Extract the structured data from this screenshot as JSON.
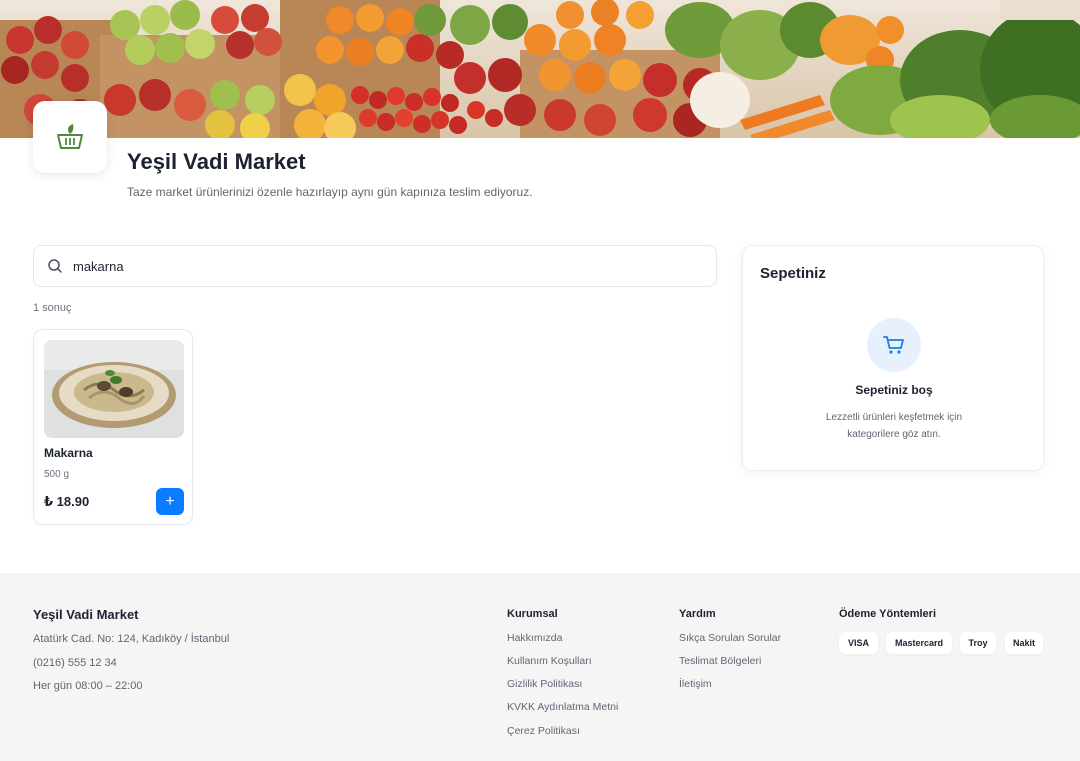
{
  "store": {
    "name": "Yeşil Vadi Market",
    "description": "Taze market ürünlerinizi özenle hazırlayıp aynı gün kapınıza teslim ediyoruz.",
    "logo_icon": "basket-leaf-icon"
  },
  "search": {
    "value": "makarna",
    "icon": "search-icon"
  },
  "results": {
    "count_label": "1 sonuç",
    "products": [
      {
        "name": "Makarna",
        "weight": "500 g",
        "price": "₺ 18.90",
        "add_label": "+"
      }
    ]
  },
  "cart": {
    "title": "Sepetiniz",
    "empty_title": "Sepetiniz boş",
    "empty_desc": "Lezzetli ürünleri keşfetmek için kategorilere göz atın.",
    "icon": "cart-icon"
  },
  "footer": {
    "brand": "Yeşil Vadi Market",
    "address": "Atatürk Cad. No: 124, Kadıköy / İstanbul",
    "phone": "(0216) 555 12 34",
    "hours": "Her gün 08:00 – 22:00",
    "corporate": {
      "title": "Kurumsal",
      "links": [
        "Hakkımızda",
        "Kullanım Koşulları",
        "Gizlilik Politikası",
        "KVKK Aydınlatma Metni",
        "Çerez Politikası"
      ]
    },
    "help": {
      "title": "Yardım",
      "links": [
        "Sıkça Sorulan Sorular",
        "Teslimat Bölgeleri",
        "İletişim"
      ]
    },
    "payment": {
      "title": "Ödeme Yöntemleri",
      "methods": [
        "VISA",
        "Mastercard",
        "Troy",
        "Nakit"
      ]
    }
  },
  "colors": {
    "accent": "#0a7cff",
    "logo_green": "#4f8a3c",
    "footer_bg": "#f5f5f6"
  }
}
